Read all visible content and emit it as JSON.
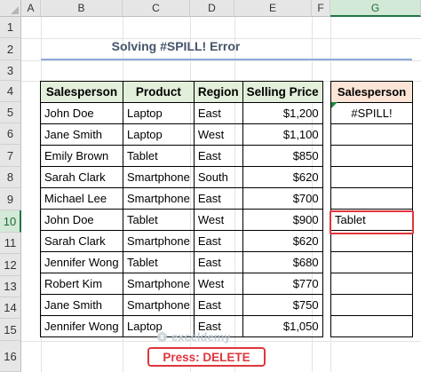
{
  "columns": [
    "A",
    "B",
    "C",
    "D",
    "E",
    "F",
    "G"
  ],
  "rows": [
    "1",
    "2",
    "3",
    "4",
    "5",
    "6",
    "7",
    "8",
    "9",
    "10",
    "11",
    "12",
    "13",
    "14",
    "15",
    "16"
  ],
  "title": "Solving #SPILL! Error",
  "table": {
    "headers": [
      "Salesperson",
      "Product",
      "Region",
      "Selling Price"
    ],
    "rows": [
      [
        "John Doe",
        "Laptop",
        "East",
        "$1,200"
      ],
      [
        "Jane Smith",
        "Laptop",
        "West",
        "$1,100"
      ],
      [
        "Emily Brown",
        "Tablet",
        "East",
        "$850"
      ],
      [
        "Sarah Clark",
        "Smartphone",
        "South",
        "$620"
      ],
      [
        "Michael Lee",
        "Smartphone",
        "East",
        "$700"
      ],
      [
        "John Doe",
        "Tablet",
        "West",
        "$900"
      ],
      [
        "Sarah Clark",
        "Smartphone",
        "East",
        "$620"
      ],
      [
        "Jennifer Wong",
        "Tablet",
        "East",
        "$680"
      ],
      [
        "Robert Kim",
        "Smartphone",
        "West",
        "$770"
      ],
      [
        "Jane Smith",
        "Smartphone",
        "East",
        "$750"
      ],
      [
        "Jennifer Wong",
        "Laptop",
        "East",
        "$1,050"
      ]
    ]
  },
  "g_column": {
    "header": "Salesperson",
    "values": [
      "#SPILL!",
      "",
      "",
      "",
      "",
      "Tablet",
      "",
      "",
      "",
      "",
      ""
    ]
  },
  "active_column": "G",
  "active_row": "10",
  "press_label": "Press: DELETE",
  "watermark": "exceldemy",
  "colors": {
    "accent": "#e0353d",
    "header_green": "#e2efda",
    "header_peach": "#fce4d6",
    "title_rule": "#8ea9db"
  }
}
